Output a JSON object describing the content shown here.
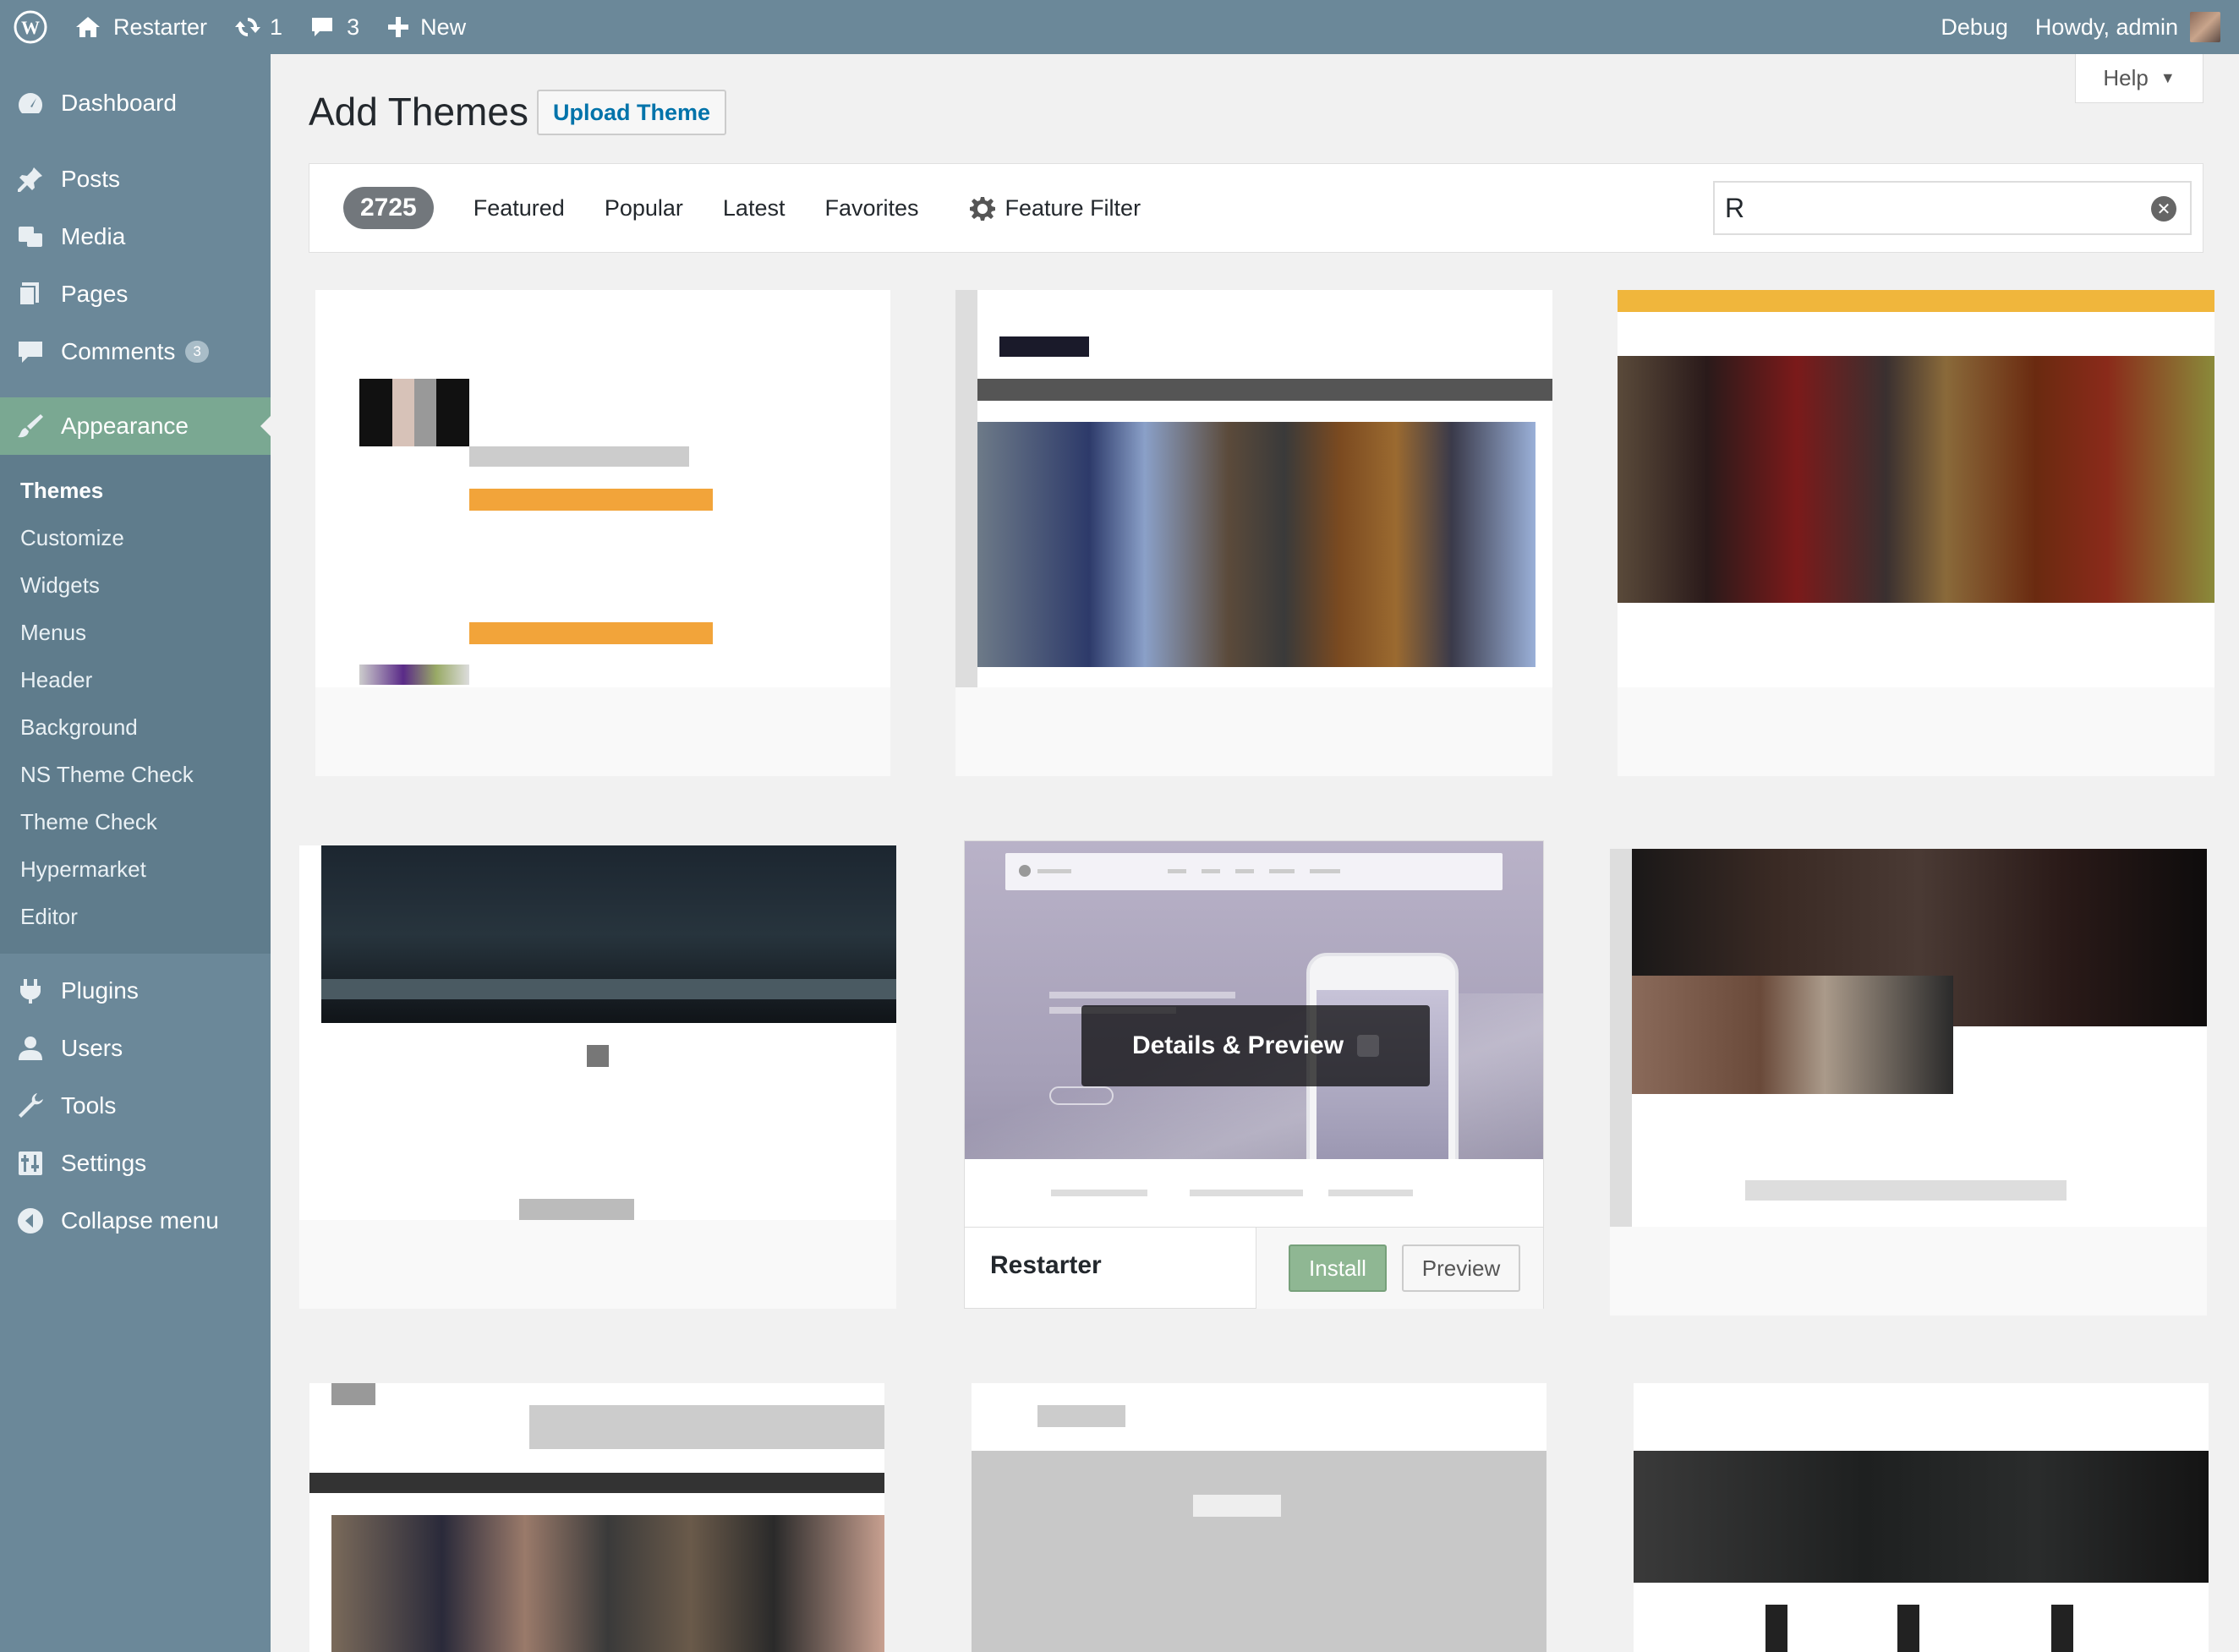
{
  "admin_bar": {
    "site_name": "Restarter",
    "updates_count": "1",
    "comments_count": "3",
    "new_label": "New",
    "debug_label": "Debug",
    "howdy_label": "Howdy, admin"
  },
  "sidebar": {
    "items": [
      {
        "label": "Dashboard",
        "icon": "dashboard-icon"
      },
      {
        "label": "Posts",
        "icon": "pin-icon"
      },
      {
        "label": "Media",
        "icon": "media-icon"
      },
      {
        "label": "Pages",
        "icon": "pages-icon"
      },
      {
        "label": "Comments",
        "icon": "comment-icon",
        "badge": "3"
      },
      {
        "label": "Appearance",
        "icon": "paintbrush-icon",
        "current": true
      },
      {
        "label": "Plugins",
        "icon": "plugin-icon"
      },
      {
        "label": "Users",
        "icon": "user-icon"
      },
      {
        "label": "Tools",
        "icon": "wrench-icon"
      },
      {
        "label": "Settings",
        "icon": "settings-icon"
      },
      {
        "label": "Collapse menu",
        "icon": "collapse-icon"
      }
    ],
    "appearance_submenu": [
      "Themes",
      "Customize",
      "Widgets",
      "Menus",
      "Header",
      "Background",
      "NS Theme Check",
      "Theme Check",
      "Hypermarket",
      "Editor"
    ]
  },
  "header": {
    "title": "Add Themes",
    "upload_label": "Upload Theme",
    "help_label": "Help"
  },
  "filter_bar": {
    "count": "2725",
    "tabs": [
      "Featured",
      "Popular",
      "Latest",
      "Favorites"
    ],
    "feature_filter_label": "Feature Filter",
    "search_value": "R"
  },
  "featured_theme": {
    "name": "Restarter",
    "overlay_label": "Details & Preview",
    "install_label": "Install",
    "preview_label": "Preview"
  },
  "colors": {
    "sidebar": "#6b8899",
    "accent_current": "#7aa892",
    "link": "#0073aa",
    "install": "#8fb793"
  }
}
